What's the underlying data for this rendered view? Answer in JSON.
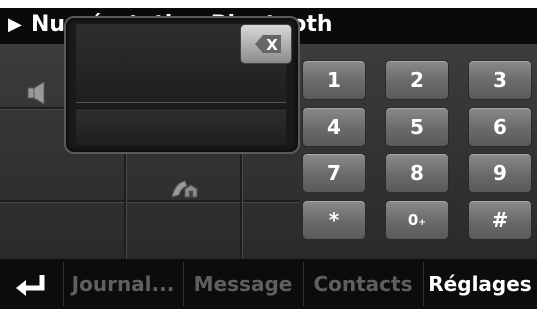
{
  "header": {
    "arrow_glyph": "▶",
    "title": "Numérotation Bluetooth"
  },
  "keypad": [
    {
      "label": "1",
      "name": "key-1"
    },
    {
      "label": "2",
      "name": "key-2"
    },
    {
      "label": "3",
      "name": "key-3"
    },
    {
      "label": "4",
      "name": "key-4"
    },
    {
      "label": "5",
      "name": "key-5"
    },
    {
      "label": "6",
      "name": "key-6"
    },
    {
      "label": "7",
      "name": "key-7"
    },
    {
      "label": "8",
      "name": "key-8"
    },
    {
      "label": "9",
      "name": "key-9"
    },
    {
      "label": "*",
      "name": "key-star"
    },
    {
      "label": "0₊",
      "name": "key-0"
    },
    {
      "label": "#",
      "name": "key-hash"
    }
  ],
  "bottom_bar": {
    "tabs": [
      {
        "label": "Journal...",
        "state": "disabled",
        "name": "tab-journal"
      },
      {
        "label": "Message",
        "state": "disabled",
        "name": "tab-message"
      },
      {
        "label": "Contacts",
        "state": "disabled",
        "name": "tab-contacts"
      },
      {
        "label": "Réglages",
        "state": "active",
        "name": "tab-reglages"
      }
    ]
  },
  "icons": {
    "speaker": "speaker-icon",
    "redial": "redial-icon",
    "backspace": "backspace-icon",
    "back": "back-arrow-icon"
  },
  "colors": {
    "background": "#151515",
    "key_face": "#6a6a6a",
    "disabled_text": "#5f5f5f",
    "active_text": "#ffffff"
  }
}
